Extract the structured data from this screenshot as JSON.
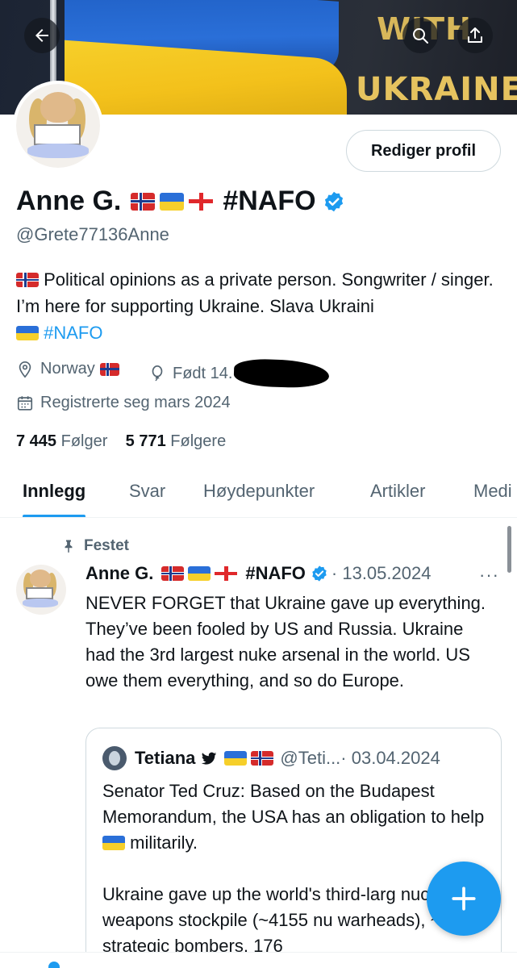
{
  "banner": {
    "line1": "WITH",
    "line2": "UKRAINE"
  },
  "profile": {
    "edit_label": "Rediger profil",
    "name": "Anne G.",
    "name_tag": "#NAFO",
    "handle": "@Grete77136Anne",
    "bio_line1": "Political opinions as a private person. Songwriter / singer. I’m here for supporting Ukraine. Slava Ukraini",
    "bio_link": "#NAFO",
    "location": "Norway",
    "born": "Født 14.",
    "joined": "Registrerte seg mars 2024",
    "following_count": "7 445",
    "following_label": "Følger",
    "followers_count": "5 771",
    "followers_label": "Følgere"
  },
  "tabs": [
    {
      "label": "Innlegg",
      "active": true
    },
    {
      "label": "Svar"
    },
    {
      "label": "Høydepunkter"
    },
    {
      "label": "Artikler"
    },
    {
      "label": "Medi"
    }
  ],
  "pinned_tweet": {
    "pinned_label": "Festet",
    "author": "Anne G.",
    "tag": "#NAFO",
    "date": "· 13.05.2024",
    "more": "···",
    "text": "NEVER FORGET that Ukraine gave up everything. They’ve been fooled by US and Russia. Ukraine had the 3rd largest nuke arsenal in the world. US owe them everything, and so do Europe.",
    "quote": {
      "author": "Tetiana",
      "handle": "@Teti...",
      "date": "· 03.04.2024",
      "text_p1": "Senator Ted Cruz: Based on the Budapest Memorandum, the USA has an obligation to help",
      "text_p1_end": "militarily.",
      "text_p2": "Ukraine gave up the world's third-larg nuclear weapons stockpile (~4155 nu warheads), ~100 strategic bombers, 176"
    }
  },
  "colors": {
    "accent": "#1d9bf0",
    "text": "#0f1419",
    "muted": "#536471"
  },
  "icons": [
    "back-arrow-icon",
    "search-icon",
    "share-icon",
    "verified-icon",
    "location-icon",
    "balloon-icon",
    "calendar-icon",
    "pin-icon",
    "bird-icon",
    "plus-icon"
  ]
}
